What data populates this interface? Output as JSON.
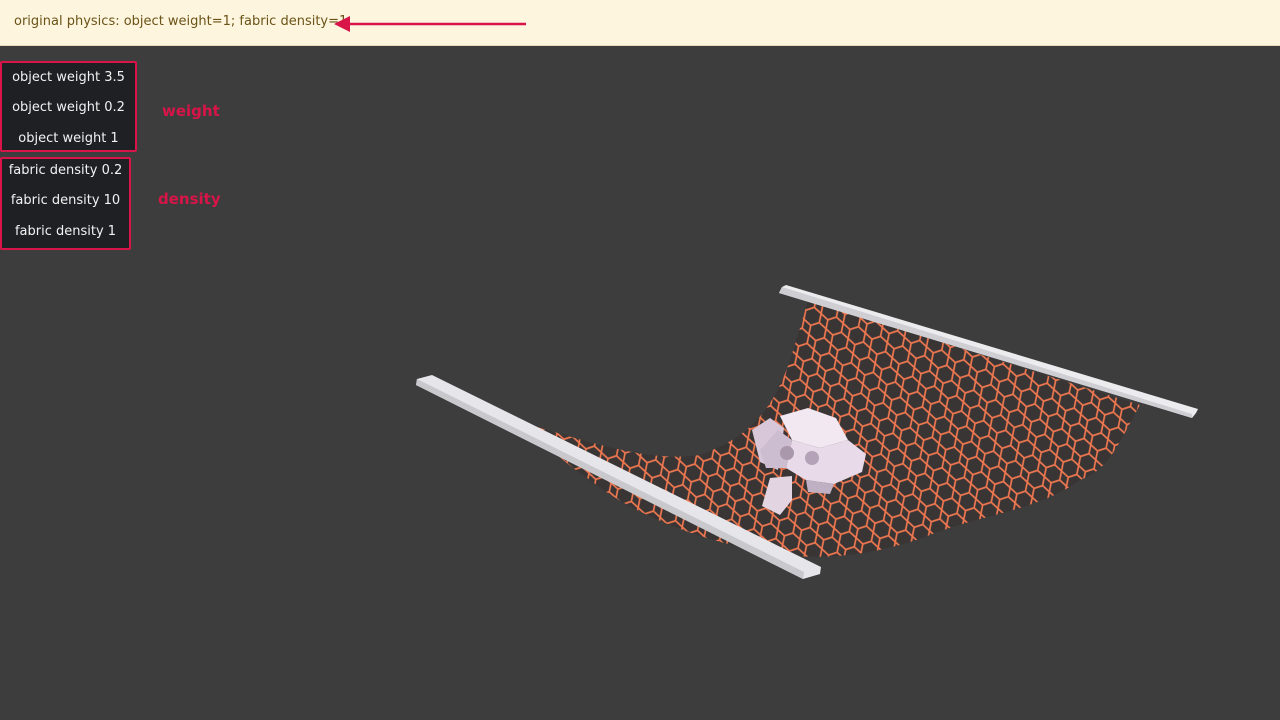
{
  "banner": {
    "text": "original physics: object weight=1; fabric density=1"
  },
  "weight_group": {
    "annotation": "weight",
    "buttons": [
      "object weight 3.5",
      "object weight 0.2",
      "object weight 1"
    ]
  },
  "density_group": {
    "annotation": "density",
    "buttons": [
      "fabric density 0.2",
      "fabric density 10",
      "fabric density 1"
    ]
  },
  "colors": {
    "background": "#3d3d3d",
    "banner": "#fdf5dd",
    "accent": "#d81448",
    "fabric": "#f07850",
    "rod": "#e2e2e6",
    "object": "#e8d8e6"
  }
}
